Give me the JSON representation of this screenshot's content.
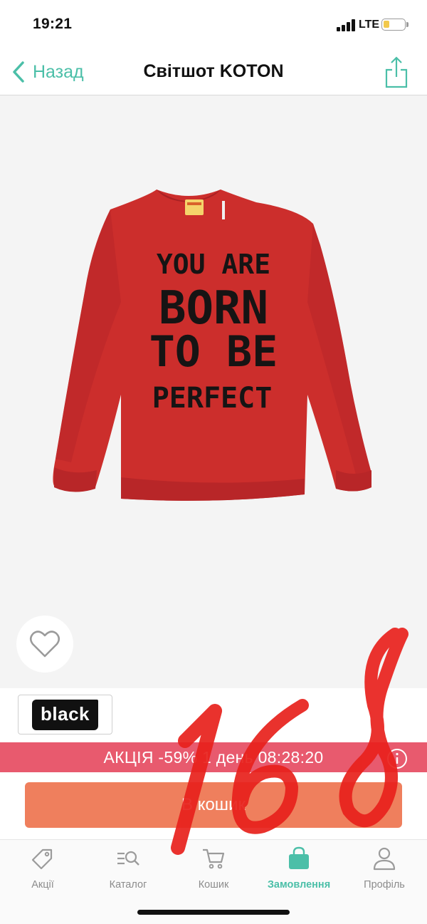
{
  "status_bar": {
    "time": "19:21",
    "network": "LTE",
    "battery_level": 0.2,
    "battery_color": "#f2c94c"
  },
  "nav": {
    "back_label": "Назад",
    "title": "Світшот KOTON",
    "back_icon": "chevron-left-icon",
    "share_icon": "share-icon",
    "accent_color": "#4bbfa8"
  },
  "product": {
    "image_icon": "red-sweatshirt-image",
    "print_lines": [
      "YOU ARE",
      "BORN",
      "TO BE",
      "PERFECT"
    ],
    "garment_color": "#cc2e2c",
    "favorite_icon": "heart-icon"
  },
  "brand": {
    "logo_text": "black"
  },
  "promo": {
    "text": "АКЦІЯ -59% 1 день 08:28:20",
    "info_icon": "info-icon",
    "color": "#e85a6e"
  },
  "cart": {
    "button_label": "В кошик",
    "color": "#ef7f5d"
  },
  "tabs": [
    {
      "label": "Акції",
      "icon": "tag-icon",
      "active": false
    },
    {
      "label": "Каталог",
      "icon": "catalog-search-icon",
      "active": false
    },
    {
      "label": "Кошик",
      "icon": "cart-icon",
      "active": false
    },
    {
      "label": "Замовлення",
      "icon": "shopping-bag-icon",
      "active": true
    },
    {
      "label": "Профіль",
      "icon": "profile-icon",
      "active": false
    }
  ],
  "annotation": {
    "handwritten_text": "16 8",
    "ink_color": "#e8211c"
  }
}
